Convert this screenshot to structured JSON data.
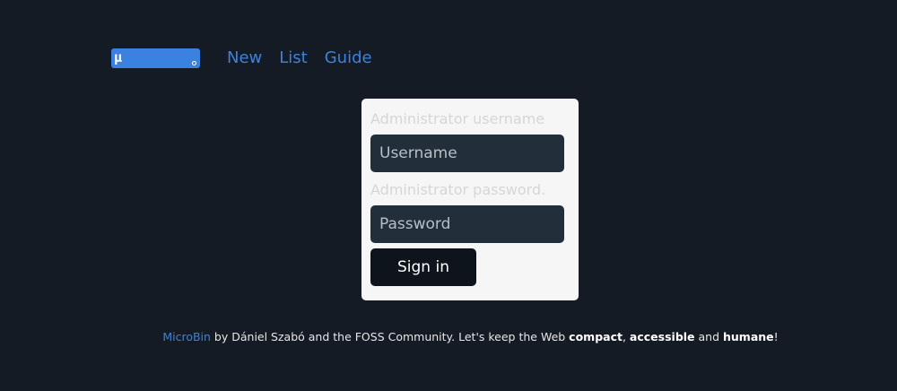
{
  "nav": {
    "logo_text": "μ",
    "links": [
      "New",
      "List",
      "Guide"
    ]
  },
  "login": {
    "username_label": "Administrator username",
    "username_placeholder": "Username",
    "password_label": "Administrator password.",
    "password_placeholder": "Password",
    "signin_label": "Sign in"
  },
  "footer": {
    "brand": "MicroBin",
    "text_1": " by Dániel Szabó and the FOSS Community. Let's keep the Web ",
    "word_compact": "compact",
    "sep_1": ", ",
    "word_accessible": "accessible",
    "sep_2": " and ",
    "word_humane": "humane",
    "end": "!"
  },
  "colors": {
    "background": "#151b24",
    "accent": "#3b82e0",
    "card": "#f6f6f6",
    "input": "#232e3b",
    "button": "#0e141b"
  }
}
